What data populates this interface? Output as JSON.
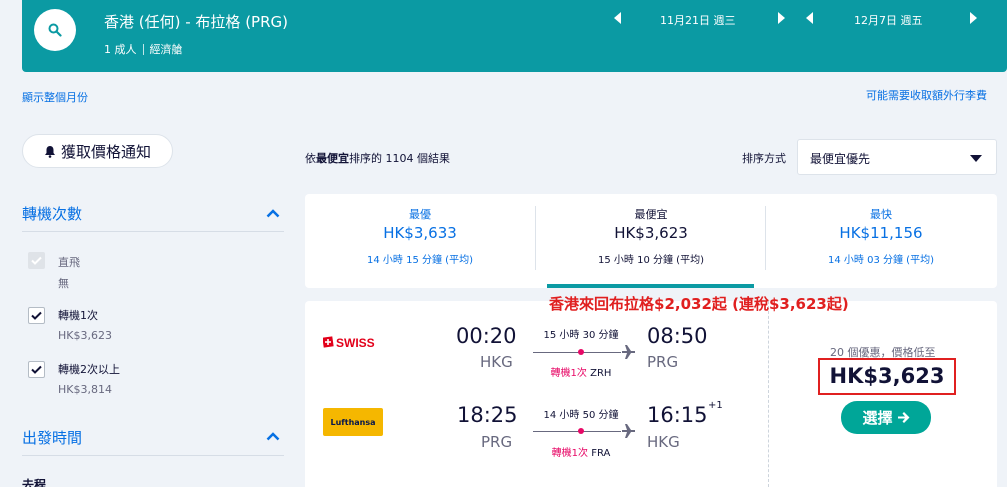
{
  "header": {
    "route": "香港 (任何) - 布拉格 (PRG)",
    "passengers": "1 成人",
    "cabin": "經濟艙",
    "depart_date": "11月21日 週三",
    "return_date": "12月7日 週五"
  },
  "links": {
    "show_month": "顯示整個月份",
    "extra_fees": "可能需要收取額外行李費"
  },
  "sidebar": {
    "price_alert": "獲取價格通知",
    "stops_title": "轉機次數",
    "stops_options": [
      {
        "label": "直飛",
        "sub": "無",
        "checked": false,
        "disabled": true
      },
      {
        "label": "轉機1次",
        "sub": "HK$3,623",
        "checked": true,
        "disabled": false
      },
      {
        "label": "轉機2次以上",
        "sub": "HK$3,814",
        "checked": true,
        "disabled": false
      }
    ],
    "depart_time_title": "出發時間",
    "outbound_label": "去程"
  },
  "results": {
    "count_prefix": "依",
    "count_bold": "最便宜",
    "count_suffix": "排序的 1104 個結果",
    "sort_label": "排序方式",
    "sort_value": "最便宜優先"
  },
  "tabs": [
    {
      "title": "最優",
      "price": "HK$3,633",
      "duration": "14 小時 15 分鐘 (平均)",
      "active": false
    },
    {
      "title": "最便宜",
      "price": "HK$3,623",
      "duration": "15 小時 10 分鐘 (平均)",
      "active": true
    },
    {
      "title": "最快",
      "price": "HK$11,156",
      "duration": "14 小時 03 分鐘 (平均)",
      "active": false
    }
  ],
  "promo": "香港來回布拉格$2,032起 (連稅$3,623起)",
  "flight": {
    "outbound": {
      "airline": "SWISS",
      "depart_time": "00:20",
      "depart_code": "HKG",
      "duration": "15 小時 30 分鐘",
      "stops": "轉機1次",
      "via": "ZRH",
      "arrive_time": "08:50",
      "arrive_code": "PRG"
    },
    "inbound": {
      "airline": "Lufthansa",
      "depart_time": "18:25",
      "depart_code": "PRG",
      "duration": "14 小時 50 分鐘",
      "stops": "轉機1次",
      "via": "FRA",
      "arrive_time": "16:15",
      "day_offset": "+1",
      "arrive_code": "HKG"
    },
    "deals": "20 個優惠，價格低至",
    "price": "HK$3,623",
    "select_label": "選擇"
  },
  "colors": {
    "header_teal": "#0b9aa3",
    "link_blue": "#0770e3",
    "select_green": "#00a698",
    "stop_red": "#e70866",
    "promo_red": "#e02020"
  }
}
